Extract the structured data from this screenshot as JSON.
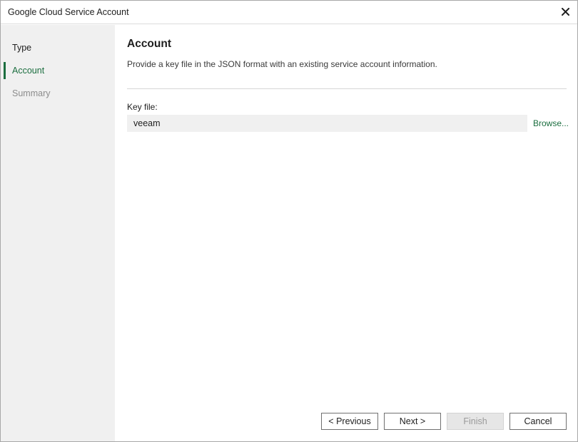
{
  "window": {
    "title": "Google Cloud Service Account",
    "close_icon": "close-icon"
  },
  "sidebar": {
    "steps": [
      {
        "label": "Type",
        "state": "done"
      },
      {
        "label": "Account",
        "state": "active"
      },
      {
        "label": "Summary",
        "state": "pending"
      }
    ]
  },
  "main": {
    "title": "Account",
    "description": "Provide a key file in the JSON format with an existing service account information.",
    "key_file": {
      "label": "Key file:",
      "value": "veeam",
      "browse_label": "Browse..."
    }
  },
  "buttons": {
    "previous": "< Previous",
    "next": "Next >",
    "finish": "Finish",
    "cancel": "Cancel"
  },
  "colors": {
    "accent": "#1b6e3f",
    "sidebar_bg": "#f0f0f0",
    "disabled_text": "#9a9a9a"
  }
}
